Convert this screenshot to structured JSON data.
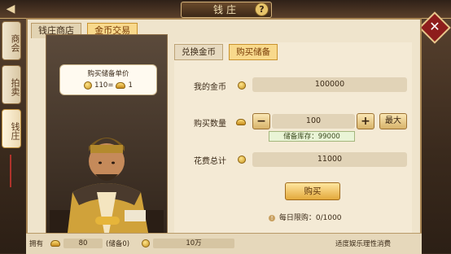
{
  "window": {
    "title": "钱庄",
    "help": "?",
    "close": "✕"
  },
  "side_tabs": [
    {
      "label": "商会"
    },
    {
      "label": "拍卖"
    },
    {
      "label": "钱庄"
    }
  ],
  "panel_tabs": [
    {
      "label": "钱庄商店"
    },
    {
      "label": "金币交易"
    }
  ],
  "bubble": {
    "title": "购买储备单价",
    "rate_left": "110=",
    "rate_right": "1"
  },
  "sub_tabs": [
    {
      "label": "兑换金币"
    },
    {
      "label": "购买储备"
    }
  ],
  "form": {
    "my_gold_label": "我的金币",
    "my_gold_value": "100000",
    "buy_qty_label": "购买数量",
    "buy_qty_value": "100",
    "minus": "−",
    "plus": "+",
    "max_label": "最大",
    "stock_text": "储备库存：99000",
    "total_label": "花费总计",
    "total_value": "11000",
    "buy_label": "购买",
    "daily_limit": "每日限购：0/1000"
  },
  "bottom": {
    "own_label": "拥有",
    "ingot_value": "80",
    "ingot_note": "(储备0)",
    "coin_value": "10万",
    "slogan": "适度娱乐理性消费"
  }
}
